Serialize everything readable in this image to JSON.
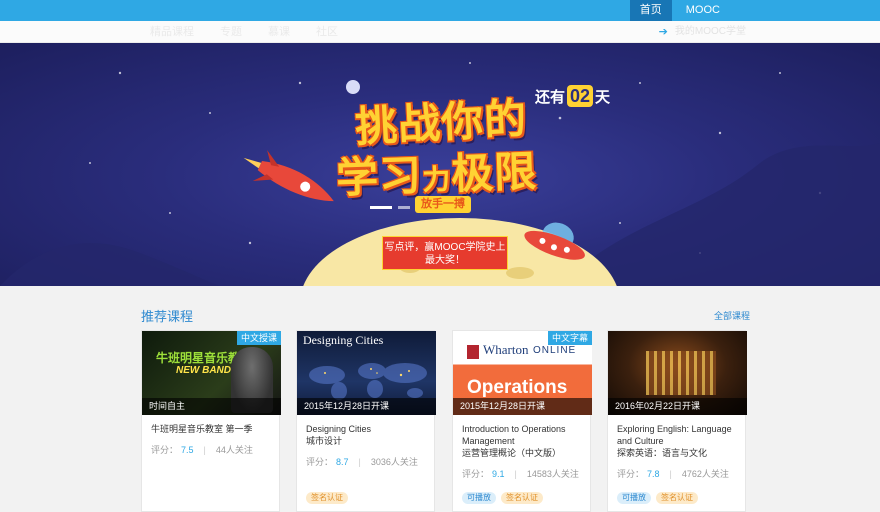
{
  "topnav": {
    "home": "首页",
    "mooc": "MOOC"
  },
  "subnav": {
    "links": [
      "精品课程",
      "专题",
      "慕课",
      "社区"
    ],
    "mymooc": "我的MOOC学堂"
  },
  "banner": {
    "countdown_prefix": "还有",
    "countdown_num": "02",
    "countdown_suffix": "天",
    "line1": "挑战你的",
    "line2a": "学习",
    "line2b": "力",
    "line2c": "极限",
    "go_button": "放手一搏",
    "prize_line1": "写点评，赢MOOC学院史上",
    "prize_line2": "最大奖！"
  },
  "section": {
    "title": "推荐课程",
    "all_link": "全部课程"
  },
  "courses": [
    {
      "caption": "时间自主",
      "tag": "中文授课",
      "thumb_title": "牛班明星音乐教室",
      "thumb_sub": "NEW BAND",
      "title": "牛班明星音乐教室 第一季",
      "score_label": "评分：",
      "score": "7.5",
      "followers": "44人关注",
      "badges": []
    },
    {
      "caption": "2015年12月28日开课",
      "tag": "",
      "thumb_title": "Designing Cities",
      "title": "Designing Cities",
      "subtitle": "城市设计",
      "score_label": "评分：",
      "score": "8.7",
      "followers": "3036人关注",
      "badges": [
        "签名认证"
      ]
    },
    {
      "caption": "2015年12月28日开课",
      "tag": "中文字幕",
      "thumb_title": "Wharton",
      "thumb_online": "ONLINE",
      "thumb_ops": "Operations",
      "title": "Introduction to Operations Management",
      "subtitle": "运营管理概论（中文版）",
      "score_label": "评分：",
      "score": "9.1",
      "followers": "14583人关注",
      "badges": [
        "可播放",
        "签名认证"
      ]
    },
    {
      "caption": "2016年02月22日开课",
      "tag": "",
      "title": "Exploring English: Language and Culture",
      "subtitle": "探索英语：语言与文化",
      "score_label": "评分：",
      "score": "7.8",
      "followers": "4762人关注",
      "badges": [
        "可播放",
        "签名认证"
      ]
    }
  ],
  "colors": {
    "brand": "#2fa8e4",
    "banner_bg": "#2a2d7c",
    "headline": "#ffd233"
  }
}
